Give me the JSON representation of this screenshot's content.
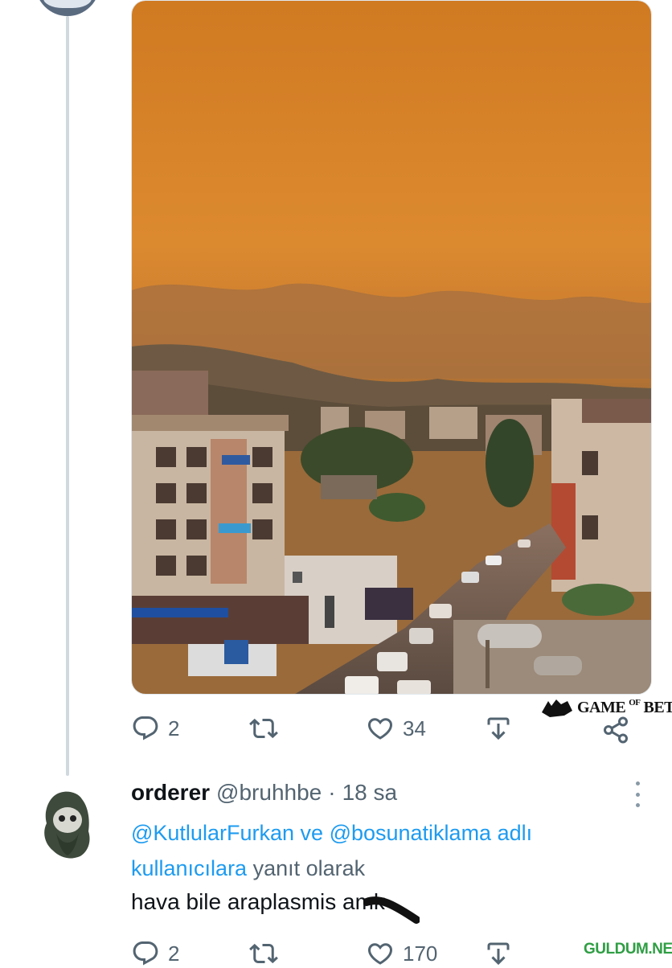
{
  "tweet": {
    "actions": {
      "reply_count": "2",
      "like_count": "34"
    },
    "watermark_prefix": "GAME",
    "watermark_mid": "OF",
    "watermark_suffix": "BET"
  },
  "reply": {
    "name": "orderer",
    "handle": "@bruhhbe",
    "separator": "·",
    "time": "18 sa",
    "mention_1": "@KutlularFurkan",
    "connector": "ve",
    "mention_2": "@bosunatiklama",
    "mention_tail_1": "adlı",
    "mention_tail_2": "kullanıcılara",
    "reply_suffix": "yanıt olarak",
    "body_text": "hava bile araplasmis amk",
    "actions": {
      "reply_count": "2",
      "like_count": "170"
    }
  },
  "site_watermark": "GULDUM.NET",
  "icons": {
    "reply": "speech-bubble-icon",
    "retweet": "retweet-icon",
    "like": "heart-icon",
    "bookmark": "bookmark-download-icon",
    "share": "share-icon",
    "more": "more-options-icon"
  },
  "colors": {
    "accent": "#1d9bf0",
    "muted": "#536471",
    "sky": "#d9852b",
    "thread_line": "#cfd9de"
  }
}
